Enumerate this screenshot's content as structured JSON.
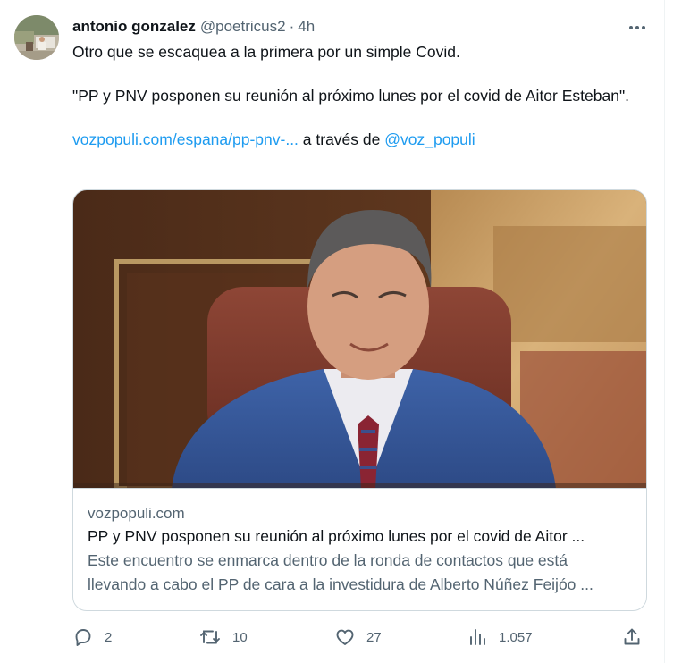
{
  "tweet": {
    "author_name": "antonio gonzalez",
    "author_handle": "@poetricus2",
    "separator": "·",
    "time": "4h",
    "text_line1": "Otro que se escaquea a la primera por un simple Covid.",
    "text_quote": "\"PP y PNV posponen su reunión al próximo lunes por el covid de Aitor Esteban\".",
    "link_url": "vozpopuli.com/espana/pp-pnv-...",
    "via_text": " a través de ",
    "via_handle": "@voz_populi"
  },
  "card": {
    "domain": "vozpopuli.com",
    "title": "PP y PNV posponen su reunión al próximo lunes por el covid de Aitor ...",
    "desc_line1": "Este encuentro se enmarca dentro de la ronda de contactos que está",
    "desc_line2": "llevando a cabo el PP de cara a la investidura de Alberto Núñez Feijóo ..."
  },
  "actions": {
    "replies": "2",
    "retweets": "10",
    "likes": "27",
    "views": "1.057"
  },
  "colors": {
    "accent": "#1d9bf0",
    "secondary_text": "#536471",
    "border": "#cfd9de"
  },
  "icons": [
    "more-icon",
    "reply-icon",
    "retweet-icon",
    "like-icon",
    "views-icon",
    "share-icon"
  ]
}
